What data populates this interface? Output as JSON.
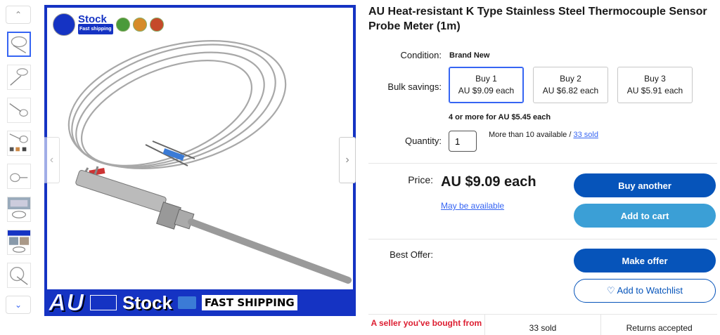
{
  "product": {
    "title": "AU Heat-resistant K Type Stainless Steel Thermocouple Sensor Probe Meter (1m)"
  },
  "gallery": {
    "logo_text": "Stock",
    "logo_sub": "Fast shipping",
    "banner": {
      "au": "AU",
      "stock": "Stock",
      "fast": "FAST SHIPPING"
    },
    "thumb_count": 9,
    "selected_thumb": 1
  },
  "details": {
    "condition_label": "Condition:",
    "condition_value": "Brand New",
    "bulk_label": "Bulk savings:",
    "bulk_options": [
      {
        "qty": "Buy 1",
        "price": "AU $9.09 each"
      },
      {
        "qty": "Buy 2",
        "price": "AU $6.82 each"
      },
      {
        "qty": "Buy 3",
        "price": "AU $5.91 each"
      }
    ],
    "bulk_more": "4 or more for AU $5.45 each",
    "quantity_label": "Quantity:",
    "quantity_value": "1",
    "availability": "More than 10 available / ",
    "sold_link": "33 sold"
  },
  "pricing": {
    "price_label": "Price:",
    "price_value": "AU $9.09 each",
    "may_be_available": "May be available",
    "buy_another": "Buy another",
    "add_to_cart": "Add to cart",
    "best_offer_label": "Best Offer:",
    "make_offer": "Make offer",
    "watchlist": "♡ Add to Watchlist"
  },
  "highlights": {
    "seller": "A seller you've bought from",
    "sold": "33 sold",
    "returns": "Returns accepted"
  },
  "colors": {
    "primary_button": "#0654ba",
    "secondary_button": "#3b9fd6",
    "link": "#3665f3",
    "banner_blue": "#1533c3",
    "alert_red": "#dd1e31"
  }
}
